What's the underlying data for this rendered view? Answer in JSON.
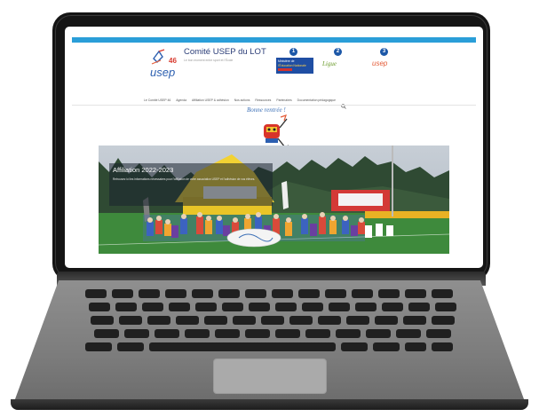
{
  "site": {
    "title": "Comité USEP du LOT",
    "tagline": "Le bon moment entre sport et l'École",
    "logo": {
      "number": "46",
      "word": "usep"
    }
  },
  "partners": [
    {
      "number": "1",
      "line1": "Ministère de",
      "line2": "l'Éducation Nationale"
    },
    {
      "number": "2",
      "text": "Ligue"
    },
    {
      "number": "3",
      "text": "usep"
    }
  ],
  "nav": {
    "items": [
      "Le Comité USEP 46",
      "Agenda",
      "Affiliation USEP & adhésion",
      "Nos actions",
      "Ressources",
      "Partenaires",
      "Documentation pédagogique"
    ]
  },
  "welcome": {
    "text": "Bonne rentrée !"
  },
  "hero": {
    "title": "Affiliation 2022-2023",
    "text": "Retrouvez ici les informations nécessaires pour l'affiliation de votre association USEP et l'adhésion de vos élèves."
  },
  "colors": {
    "accent": "#2a9ed8",
    "brand_navy": "#2c3e78",
    "partner_blue": "#1f4ea3",
    "usep_red": "#e45c38",
    "laptop_body": "#151515"
  }
}
